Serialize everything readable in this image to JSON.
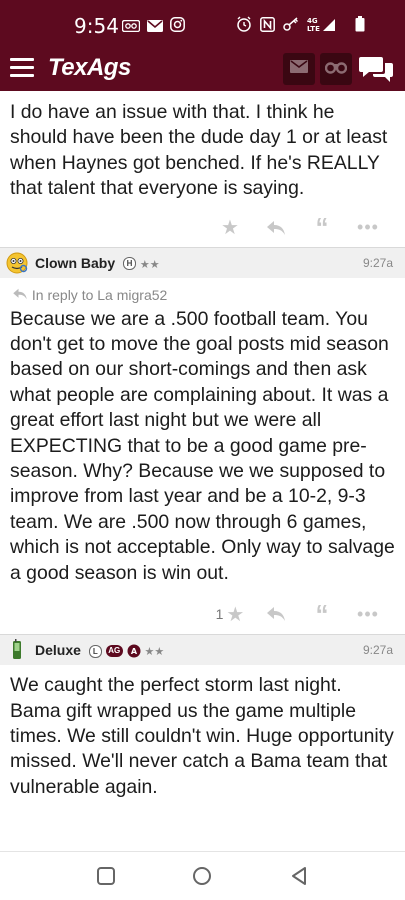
{
  "status_bar": {
    "time": "9:54",
    "network_label": "4G\nLTE"
  },
  "header": {
    "logo": "TexAgs"
  },
  "posts": [
    {
      "body": "I do have an issue with that. I think he should have been the dude day 1 or at least when Haynes got benched. If he's REALLY that talent that everyone is saying.",
      "likes": ""
    },
    {
      "username": "Clown Baby",
      "badges": [
        "H"
      ],
      "stars": "★★",
      "time": "9:27a",
      "reply_to": "In reply to La migra52",
      "body": "Because we are a .500 football team. You don't get to move the goal posts mid season based on our short-comings and then ask what people are complaining about. It was a great effort last night but we were all EXPECTING that to be a good game pre-season. Why? Because we we supposed to improve from last year and be a 10-2, 9-3 team. We are .500 now through 6 games, which is not acceptable. Only way to salvage a good season is win out.",
      "likes": "1"
    },
    {
      "username": "Deluxe",
      "badges": [
        "L",
        "AG"
      ],
      "stars": "★★",
      "time": "9:27a",
      "body": "We caught the perfect storm last night. Bama gift wrapped us the game multiple times. We still couldn't win. Huge opportunity missed. We'll never catch a Bama team that vulnerable again."
    }
  ],
  "colors": {
    "brand": "#5d0a1f",
    "action_gray": "#c8c8c8"
  }
}
